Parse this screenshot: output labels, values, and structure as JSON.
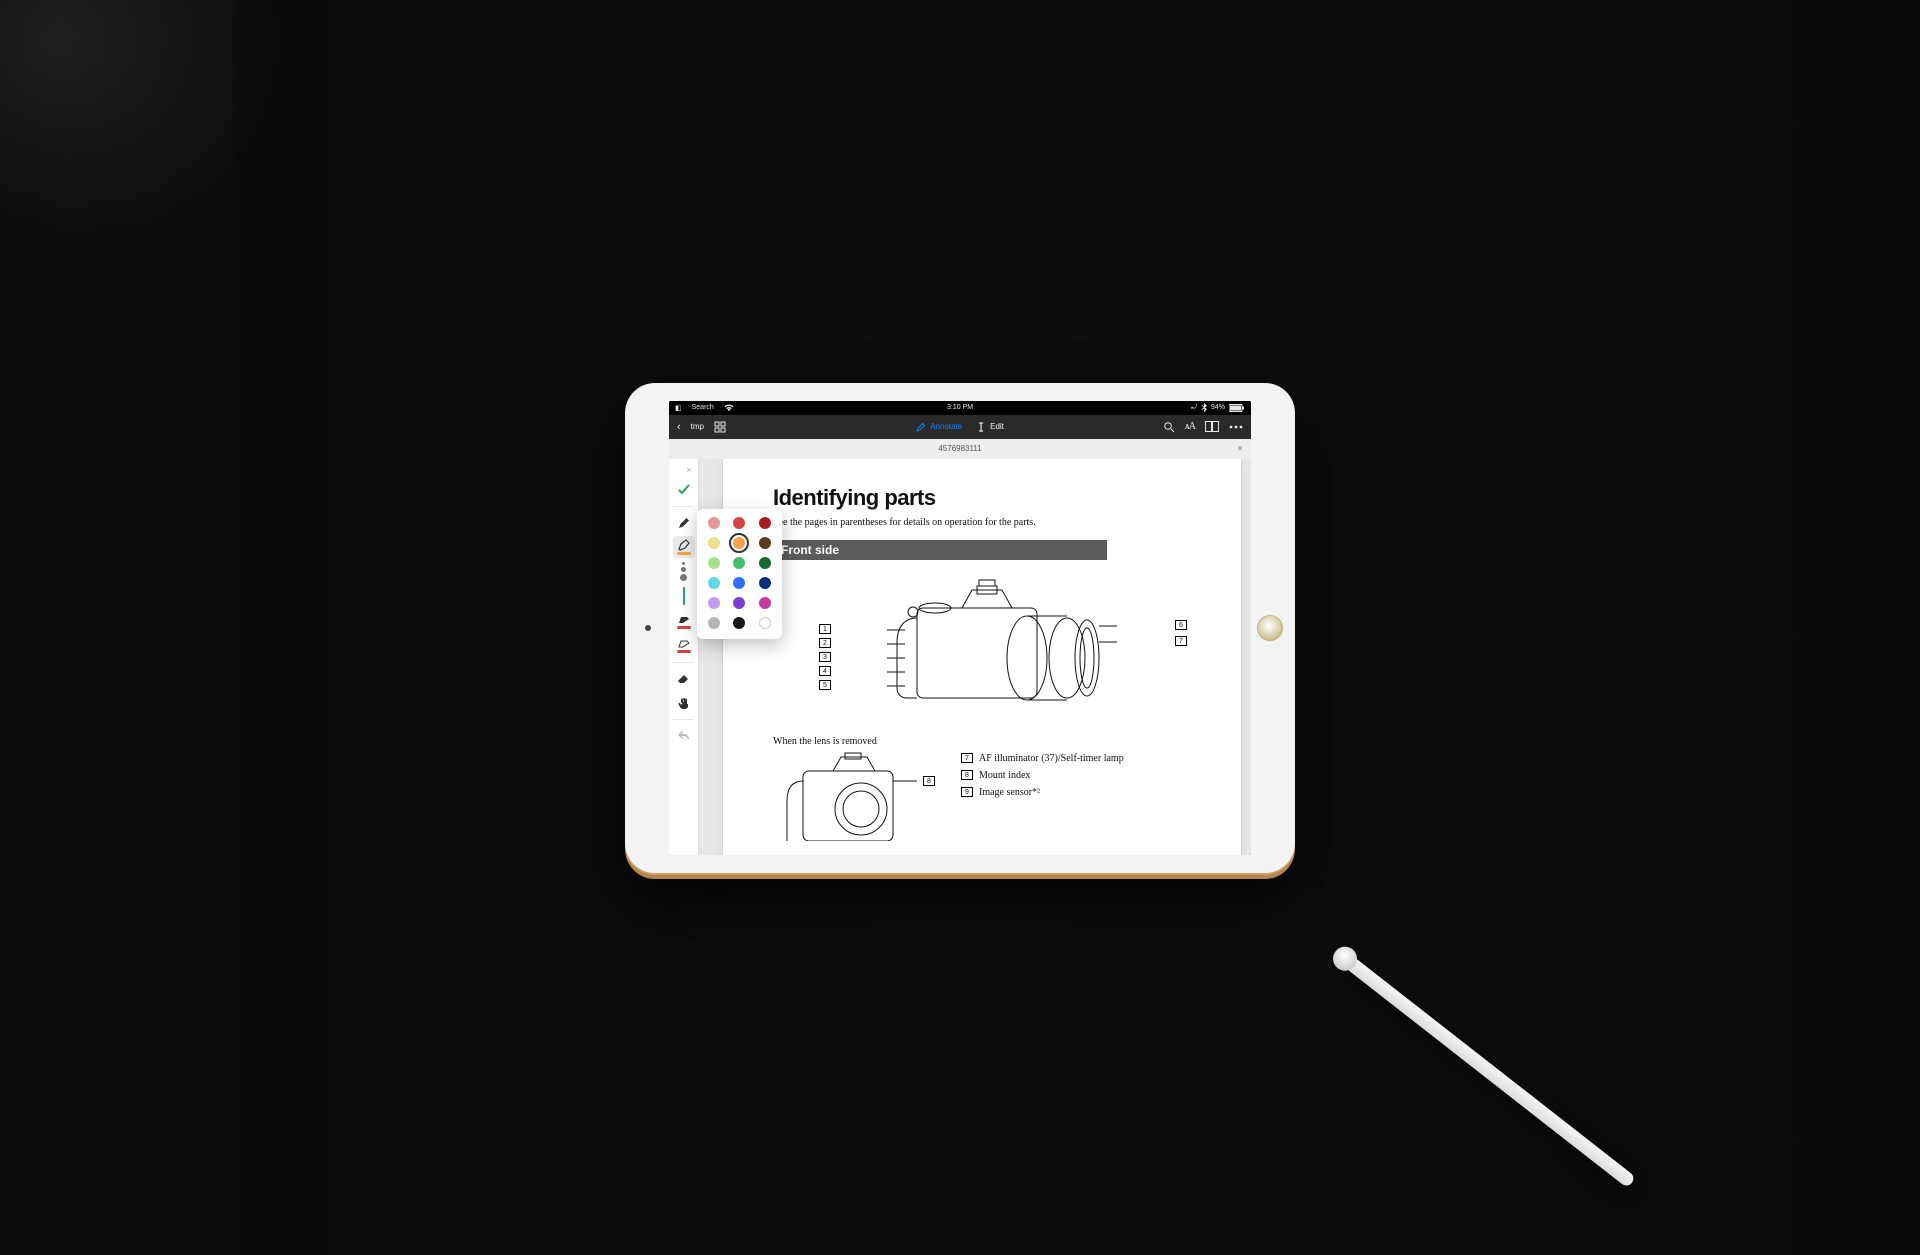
{
  "statusbar": {
    "left_label": "Search",
    "time": "3:10 PM",
    "battery_pct": "94%"
  },
  "toolbar": {
    "back_label": "tmp",
    "annotate_label": "Annotate",
    "edit_label": "Edit"
  },
  "titlebar": {
    "doc_id": "4576983111"
  },
  "rail": {
    "tools": {
      "confirm": "confirm",
      "pen": "pen",
      "highlighter": "highlighter",
      "stroke": "stroke-width",
      "underline": "underline",
      "strikethrough": "strikethrough",
      "eraser": "eraser",
      "pan": "pan-hand",
      "undo": "undo"
    },
    "highlighter_color": "#f7a34a",
    "underline_color": "#d64545",
    "strike_color": "#d64545"
  },
  "color_picker": {
    "colors": [
      "#e39898",
      "#d64545",
      "#a81f1f",
      "#efe08a",
      "#f7a34a",
      "#5b3a1e",
      "#a7e28f",
      "#43c06b",
      "#146b2e",
      "#63d6e3",
      "#2f6fff",
      "#0b2e7a",
      "#c49bf0",
      "#7a3fd1",
      "#c23aa0",
      "#b5b5b5",
      "#1a1a1a",
      "#ffffff"
    ],
    "selected_index": 4
  },
  "document": {
    "heading": "Identifying parts",
    "subtitle": "See the pages in parentheses for details on operation for the parts.",
    "section_front": "Front side",
    "callouts_front": [
      "1",
      "2",
      "3",
      "4",
      "5",
      "6",
      "7"
    ],
    "lens_removed_label": "When the lens is removed",
    "callouts_lower": [
      "8"
    ],
    "legend": [
      {
        "n": "7",
        "text": "AF illuminator (37)/Self-timer lamp"
      },
      {
        "n": "8",
        "text": "Mount index"
      },
      {
        "n": "9",
        "text": "Image sensor*²"
      }
    ]
  }
}
